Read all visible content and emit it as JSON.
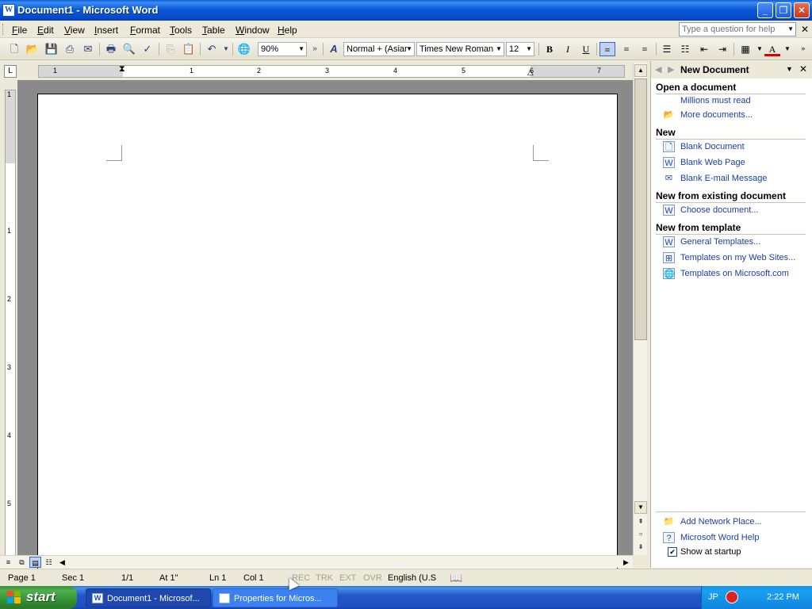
{
  "window": {
    "title": "Document1 - Microsoft Word",
    "icon": "word-doc-icon",
    "buttons": {
      "minimize": "_",
      "maximize": "❐",
      "close": "✕"
    }
  },
  "menu": {
    "items": [
      "File",
      "Edit",
      "View",
      "Insert",
      "Format",
      "Tools",
      "Table",
      "Window",
      "Help"
    ],
    "help_placeholder": "Type a question for help"
  },
  "toolbar": {
    "zoom": "90%",
    "style": "Normal + (Asiar",
    "font": "Times New Roman",
    "size": "12",
    "bold": "B",
    "italic": "I",
    "underline": "U"
  },
  "ruler": {
    "numbers": [
      "1",
      "1",
      "2",
      "3",
      "4",
      "5",
      "6",
      "7"
    ],
    "vertical_numbers": [
      "1",
      "1",
      "2",
      "3",
      "4",
      "5"
    ]
  },
  "taskpane": {
    "title": "New Document",
    "sections": [
      {
        "heading": "Open a document",
        "items": [
          {
            "label": "Millions must read",
            "icon": "none"
          },
          {
            "label": "More documents...",
            "icon": "folder-open-icon"
          }
        ]
      },
      {
        "heading": "New",
        "items": [
          {
            "label": "Blank Document",
            "icon": "blank-document-icon"
          },
          {
            "label": "Blank Web Page",
            "icon": "web-page-icon"
          },
          {
            "label": "Blank E-mail Message",
            "icon": "email-icon"
          }
        ]
      },
      {
        "heading": "New from existing document",
        "items": [
          {
            "label": "Choose document...",
            "icon": "document-icon"
          }
        ]
      },
      {
        "heading": "New from template",
        "items": [
          {
            "label": "General Templates...",
            "icon": "template-icon"
          },
          {
            "label": "Templates on my Web Sites...",
            "icon": "web-templates-icon"
          },
          {
            "label": "Templates on Microsoft.com",
            "icon": "globe-icon"
          }
        ]
      }
    ],
    "footer": {
      "add_network_place": "Add Network Place...",
      "word_help": "Microsoft Word Help",
      "show_at_startup": "Show at startup",
      "show_at_startup_checked": true
    }
  },
  "status": {
    "page": "Page  1",
    "sec": "Sec  1",
    "pages": "1/1",
    "at": "At  1\"",
    "ln": "Ln  1",
    "col": "Col  1",
    "rec": "REC",
    "trk": "TRK",
    "ext": "EXT",
    "ovr": "OVR",
    "language": "English (U.S"
  },
  "taskbar": {
    "start": "start",
    "tasks": [
      "Document1 - Microsof...",
      "Properties for Micros..."
    ],
    "lang": "JP",
    "clock": "2:22 PM"
  }
}
